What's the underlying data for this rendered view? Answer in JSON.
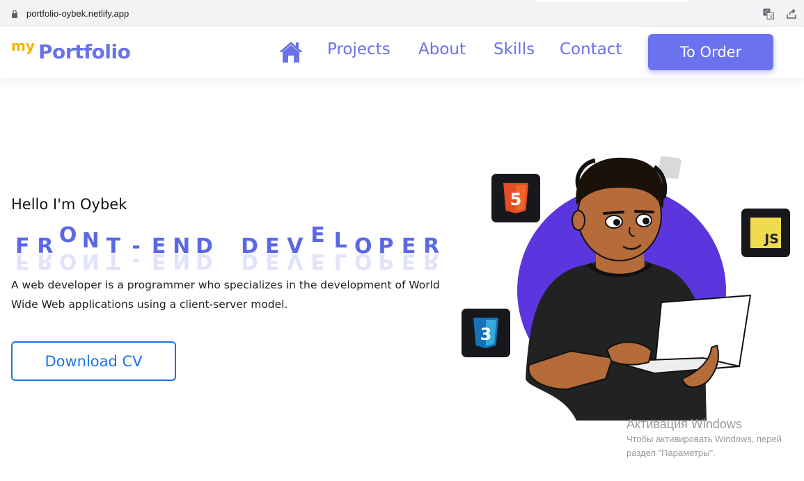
{
  "browser": {
    "url": "portfolio-oybek.netlify.app",
    "translate_icon": "translate-icon",
    "share_icon": "share-icon",
    "lock_icon": "lock-icon"
  },
  "header": {
    "logo_prefix": "my",
    "logo_main": "Portfolio",
    "home_icon": "home-icon",
    "nav": [
      "Projects",
      "About",
      "Skills",
      "Contact"
    ],
    "order_label": "To Order",
    "colors": {
      "accent": "#6a72e8",
      "logo_prefix": "#f5b400",
      "order_bg": "#6a72f0"
    }
  },
  "hero": {
    "greeting": "Hello I'm Oybek",
    "role_title": "FRONT-END DEVELOPER",
    "description": "A web developer is a programmer who specializes in the development of World Wide Web applications using a client-server model.",
    "cv_label": "Download CV",
    "colors": {
      "role": "#5b68e6",
      "cv_border": "#1a73e8"
    }
  },
  "illustration": {
    "badges": [
      {
        "icon": "html5-icon",
        "label": "5"
      },
      {
        "icon": "javascript-icon",
        "label": "JS"
      },
      {
        "icon": "css3-icon",
        "label": "3"
      }
    ],
    "colors": {
      "circle": "#5b36de",
      "skin": "#b66c3a",
      "shirt": "#222222"
    }
  },
  "watermark": {
    "title": "Активация Windows",
    "line1": "Чтобы активировать Windows, перей",
    "line2": "раздел \"Параметры\"."
  }
}
